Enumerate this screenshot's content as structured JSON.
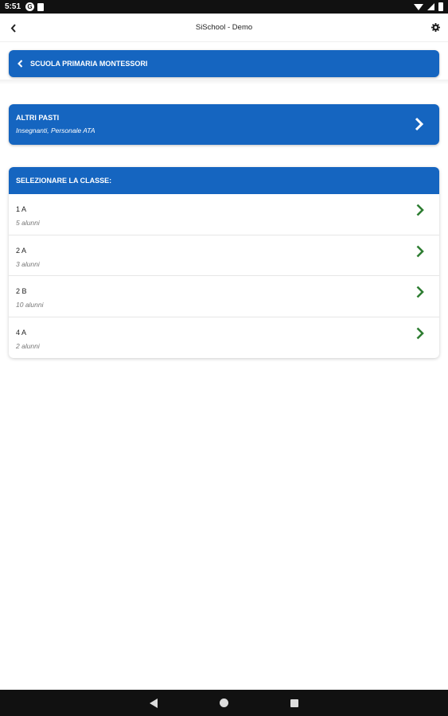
{
  "status_bar": {
    "time": "5:51",
    "notification_icons": [
      "g-icon",
      "file-icon"
    ],
    "system_icons": [
      "wifi-icon",
      "signal-icon",
      "battery-icon"
    ]
  },
  "app_bar": {
    "title": "SiSchool - Demo",
    "back_icon": "chevron-left-icon",
    "settings_icon": "gear-icon"
  },
  "school": {
    "name": "SCUOLA PRIMARIA MONTESSORI"
  },
  "altri_pasti": {
    "title": "ALTRI PASTI",
    "subtitle": "Insegnanti, Personale ATA"
  },
  "classes": {
    "header": "SELEZIONARE LA CLASSE:",
    "items": [
      {
        "name": "1 A",
        "count": "5 alunni"
      },
      {
        "name": "2 A",
        "count": "3 alunni"
      },
      {
        "name": "2 B",
        "count": "10 alunni"
      },
      {
        "name": "4 A",
        "count": "2 alunni"
      }
    ]
  },
  "colors": {
    "primary": "#1565c0",
    "chevron_green": "#2e7d32",
    "status_bar": "#111111"
  }
}
